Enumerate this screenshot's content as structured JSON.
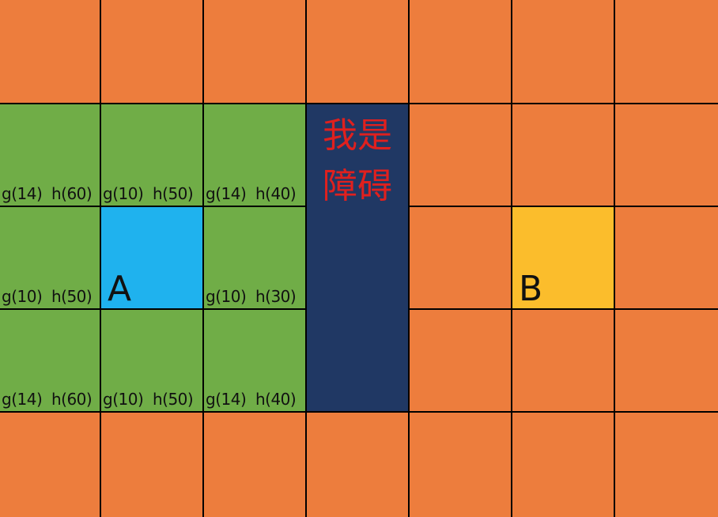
{
  "colors": {
    "background": "#ED7D3D",
    "open": "#70AD47",
    "start": "#1FB2EE",
    "goal": "#FBBD2C",
    "obstacle": "#203864",
    "obstacle_text": "#E0201E",
    "grid_line": "#000000"
  },
  "grid": {
    "rows": 5,
    "cols": 7
  },
  "obstacle": {
    "text": "我是障碍",
    "col": 3,
    "row_start": 1,
    "row_end": 3
  },
  "start": {
    "label": "A",
    "row": 2,
    "col": 1
  },
  "goal": {
    "label": "B",
    "row": 2,
    "col": 5
  },
  "open_cells": [
    {
      "row": 1,
      "col": 0,
      "label": "g(14)  h(60)"
    },
    {
      "row": 1,
      "col": 1,
      "label": "g(10)  h(50)"
    },
    {
      "row": 1,
      "col": 2,
      "label": "g(14)  h(40)"
    },
    {
      "row": 2,
      "col": 0,
      "label": "g(10)  h(50)"
    },
    {
      "row": 2,
      "col": 2,
      "label": "g(10)  h(30)"
    },
    {
      "row": 3,
      "col": 0,
      "label": "g(14)  h(60)"
    },
    {
      "row": 3,
      "col": 1,
      "label": "g(10)  h(50)"
    },
    {
      "row": 3,
      "col": 2,
      "label": "g(14)  h(40)"
    }
  ]
}
